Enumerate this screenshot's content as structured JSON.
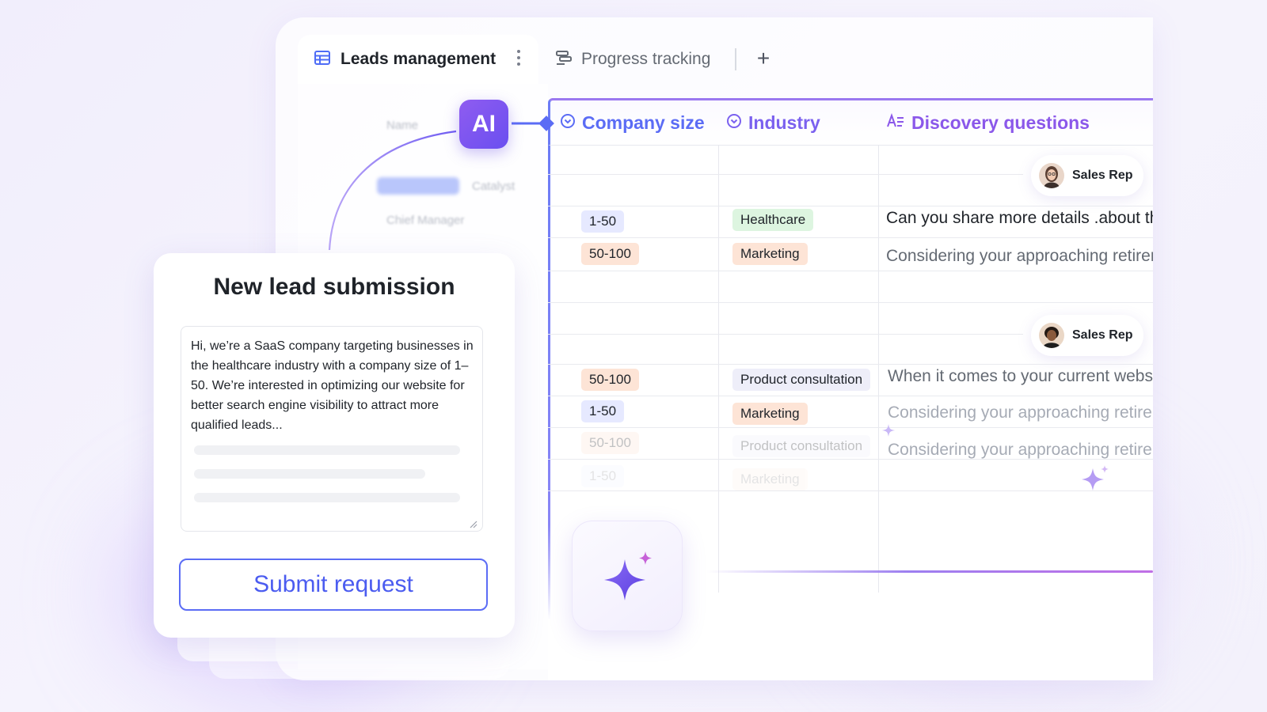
{
  "tabs": {
    "active": {
      "label": "Leads management",
      "icon": "table-icon"
    },
    "inactive": {
      "label": "Progress tracking",
      "icon": "stack-icon"
    },
    "add_label": "+"
  },
  "ai_badge": {
    "label": "AI"
  },
  "ghost_column": {
    "header": "Name",
    "tag": "Catalyst",
    "sub": "Chief Manager"
  },
  "table": {
    "headers": {
      "company_size": "Company size",
      "industry": "Industry",
      "discovery": "Discovery questions"
    },
    "groups": [
      {
        "rep_label": "Sales Rep",
        "rows": [
          {
            "size": "1-50",
            "industry": "Healthcare",
            "question": "Can you share more details .about the"
          },
          {
            "size": "50-100",
            "industry": "Marketing",
            "question": "Considering your approaching retirement"
          }
        ]
      },
      {
        "rep_label": "Sales Rep",
        "rows": [
          {
            "size": "50-100",
            "industry": "Product consultation",
            "question": "When it comes to your current website"
          },
          {
            "size": "1-50",
            "industry": "Marketing",
            "question": "Considering your approaching retirement"
          },
          {
            "size": "50-100",
            "industry": "Product consultation",
            "question": "Considering your approaching retirement"
          },
          {
            "size": "1-50",
            "industry": "Marketing",
            "question": ""
          }
        ]
      }
    ]
  },
  "form": {
    "title": "New lead submission",
    "message": "Hi, we’re a SaaS company targeting businesses in the healthcare industry with a company size of 1–50. We’re interested in optimizing our website for better search engine visibility to attract more qualified leads...",
    "submit_label": "Submit request"
  },
  "colors": {
    "accent_blue": "#5b6cf5",
    "accent_purple": "#8b58ea",
    "pill_blue": "#e6e9ff",
    "pill_orange": "#fde4d6",
    "pill_green": "#ddf5e0"
  }
}
